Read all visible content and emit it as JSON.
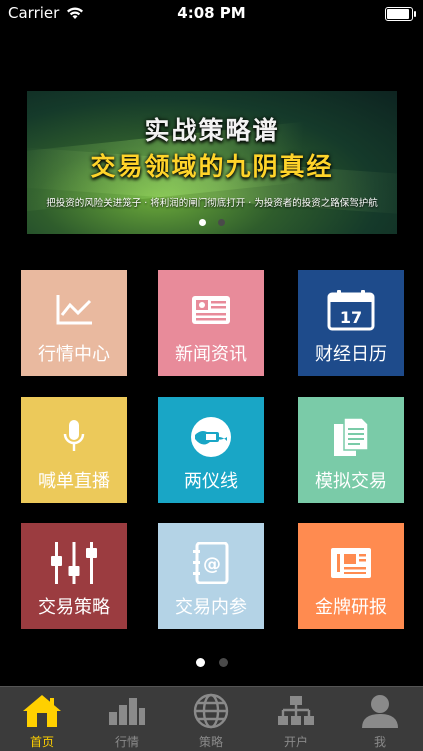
{
  "status_bar": {
    "carrier": "Carrier",
    "time": "4:08 PM",
    "battery_level": 1.0
  },
  "banner": {
    "title_line1": "实战策略谱",
    "title_line2": "交易领域的九阴真经",
    "subtitle": "把投资的风险关进笼子 · 将利润的闸门彻底打开 · 为投资者的投资之路保驾护航",
    "slides": 2,
    "active_slide": 0
  },
  "tiles": [
    {
      "label": "行情中心",
      "color": "#e9b99f",
      "icon": "chart-line-icon"
    },
    {
      "label": "新闻资讯",
      "color": "#e88b9a",
      "icon": "newspaper-icon"
    },
    {
      "label": "财经日历",
      "color": "#1e4b8b",
      "icon": "calendar-icon",
      "calendar_day": "17"
    },
    {
      "label": "喊单直播",
      "color": "#ecc95a",
      "icon": "microphone-icon"
    },
    {
      "label": "两仪线",
      "color": "#19a6c6",
      "icon": "yin-yang-icon"
    },
    {
      "label": "模拟交易",
      "color": "#7acba8",
      "icon": "documents-icon"
    },
    {
      "label": "交易策略",
      "color": "#9b3c40",
      "icon": "sliders-icon"
    },
    {
      "label": "交易内参",
      "color": "#b4d3e6",
      "icon": "address-book-icon"
    },
    {
      "label": "金牌研报",
      "color": "#ff8b50",
      "icon": "report-icon"
    }
  ],
  "grid_pager": {
    "pages": 2,
    "active_page": 0
  },
  "tabbar": {
    "tabs": [
      {
        "label": "首页",
        "icon": "home-icon",
        "active": true
      },
      {
        "label": "行情",
        "icon": "market-icon",
        "active": false
      },
      {
        "label": "策略",
        "icon": "globe-icon",
        "active": false
      },
      {
        "label": "开户",
        "icon": "hierarchy-icon",
        "active": false
      },
      {
        "label": "我",
        "icon": "user-icon",
        "active": false
      }
    ],
    "active_color": "#ffd000",
    "inactive_color": "#8a8a8a"
  }
}
